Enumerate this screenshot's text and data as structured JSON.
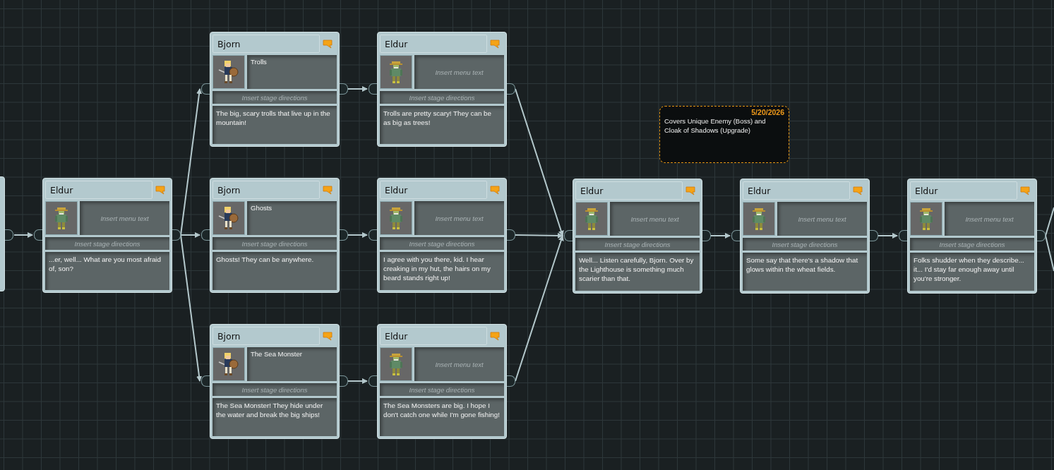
{
  "nodes": [
    {
      "speaker": "Eldur",
      "kind": "elder",
      "menu": {
        "placeholder": "Insert menu text"
      },
      "stage": {
        "placeholder": "Insert stage directions"
      },
      "dialogue": "...er, well... What are you most afraid of, son?"
    },
    {
      "speaker": "Bjorn",
      "kind": "warrior",
      "menu": {
        "value": "Trolls"
      },
      "stage": {
        "placeholder": "Insert stage directions"
      },
      "dialogue": "The big, scary trolls that live up in the mountain!"
    },
    {
      "speaker": "Eldur",
      "kind": "elder",
      "menu": {
        "placeholder": "Insert menu text"
      },
      "stage": {
        "placeholder": "Insert stage directions"
      },
      "dialogue": "Trolls are pretty scary! They can be as big as trees!"
    },
    {
      "speaker": "Bjorn",
      "kind": "warrior",
      "menu": {
        "value": "Ghosts"
      },
      "stage": {
        "placeholder": "Insert stage directions"
      },
      "dialogue": "Ghosts! They can be anywhere."
    },
    {
      "speaker": "Eldur",
      "kind": "elder",
      "menu": {
        "placeholder": "Insert menu text"
      },
      "stage": {
        "placeholder": "Insert stage directions"
      },
      "dialogue": "I agree with you there, kid. I hear creaking in my hut, the hairs on my beard stands right up!"
    },
    {
      "speaker": "Bjorn",
      "kind": "warrior",
      "menu": {
        "value": "The Sea Monster"
      },
      "stage": {
        "placeholder": "Insert stage directions"
      },
      "dialogue": "The Sea Monster! They hide under the water and break the big ships!"
    },
    {
      "speaker": "Eldur",
      "kind": "elder",
      "menu": {
        "placeholder": "Insert menu text"
      },
      "stage": {
        "placeholder": "Insert stage directions"
      },
      "dialogue": "The Sea Monsters are big. I hope I don't catch one while I'm gone fishing!"
    },
    {
      "speaker": "Eldur",
      "kind": "elder",
      "menu": {
        "placeholder": "Insert menu text"
      },
      "stage": {
        "placeholder": "Insert stage directions"
      },
      "dialogue": "Well... Listen carefully, Bjorn. Over by the Lighthouse is something much scarier than that."
    },
    {
      "speaker": "Eldur",
      "kind": "elder",
      "menu": {
        "placeholder": "Insert menu text"
      },
      "stage": {
        "placeholder": "Insert stage directions"
      },
      "dialogue": "Some say that there's a shadow that glows within the wheat fields."
    },
    {
      "speaker": "Eldur",
      "kind": "elder",
      "menu": {
        "placeholder": "Insert menu text"
      },
      "stage": {
        "placeholder": "Insert stage directions"
      },
      "dialogue": "Folks shudder when they describe... it... I'd stay far enough away until you're stronger."
    }
  ],
  "note": {
    "date": "5/20/2026",
    "text": "Covers Unique Enemy (Boss) and Cloak of Shadows (Upgrade)"
  }
}
